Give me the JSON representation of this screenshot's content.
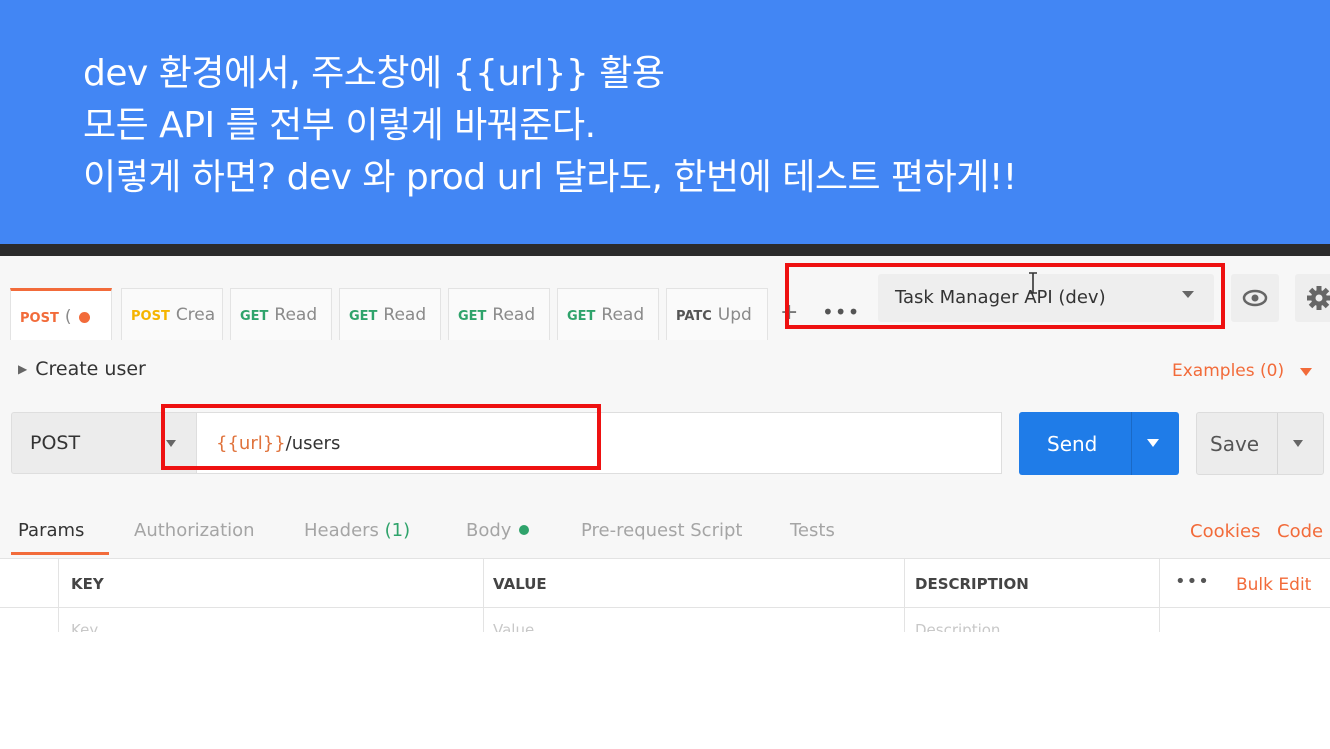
{
  "caption": {
    "line1": "dev 환경에서,   주소창에 {{url}} 활용",
    "line2": "모든 API 를 전부 이렇게 바꿔준다.",
    "line3": "이렇게 하면? dev 와 prod url 달라도, 한번에 테스트 편하게!!"
  },
  "tabs": [
    {
      "method": "POST",
      "label": "(",
      "active": true
    },
    {
      "method": "POST",
      "label": "Crea"
    },
    {
      "method": "GET",
      "label": "Read"
    },
    {
      "method": "GET",
      "label": "Read"
    },
    {
      "method": "GET",
      "label": "Read"
    },
    {
      "method": "GET",
      "label": "Read"
    },
    {
      "method": "PATC",
      "label": "Upd"
    }
  ],
  "tab_more_label": "•••",
  "tab_add_label": "+",
  "environment": {
    "selected": "Task Manager API (dev)"
  },
  "request": {
    "name": "Create user",
    "method": "POST",
    "url_variable": "{{url}}",
    "url_path": "/users"
  },
  "examples_label": "Examples (0)",
  "send_label": "Send",
  "save_label": "Save",
  "subtabs": {
    "params": "Params",
    "authorization": "Authorization",
    "headers": "Headers",
    "headers_count": "(1)",
    "body": "Body",
    "prerequest": "Pre-request Script",
    "tests": "Tests"
  },
  "links": {
    "cookies": "Cookies",
    "code": "Code"
  },
  "table": {
    "columns": [
      "KEY",
      "VALUE",
      "DESCRIPTION"
    ],
    "placeholders": [
      "Key",
      "Value",
      "Description"
    ],
    "more_label": "•••",
    "bulk_edit": "Bulk Edit"
  },
  "colors": {
    "banner": "#4286f4",
    "accent": "#f26b3a",
    "send": "#1f7ce8",
    "highlight": "#ee1111"
  }
}
